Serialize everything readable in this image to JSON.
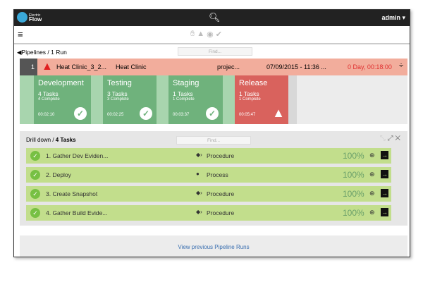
{
  "header": {
    "logo_small": "Electric",
    "logo_big": "Flow",
    "user": "admin"
  },
  "breadcrumb": "Pipelines / 1 Run",
  "find_placeholder": "Find...",
  "run": {
    "number": "1",
    "name": "Heat Clinic_3_2...",
    "pipeline": "Heat Clinic",
    "project": "projec...",
    "started": "07/09/2015 - 11:36 ...",
    "duration": "0 Day, 00:18:00"
  },
  "stages": [
    {
      "name": "Development",
      "tasks": "4 Tasks",
      "complete": "4 Complete",
      "time": "00:02:10",
      "status": "success"
    },
    {
      "name": "Testing",
      "tasks": "3 Tasks",
      "complete": "3 Complete",
      "time": "00:02:25",
      "status": "success"
    },
    {
      "name": "Staging",
      "tasks": "1 Tasks",
      "complete": "1 Complete",
      "time": "00:03:37",
      "status": "success"
    },
    {
      "name": "Release",
      "tasks": "1 Tasks",
      "complete": "1 Complete",
      "time": "00:05:47",
      "status": "warning"
    }
  ],
  "drill": {
    "prefix": "Drill down / ",
    "count": "4 Tasks",
    "tasks": [
      {
        "name": "1. Gather Dev Eviden...",
        "type": "Procedure",
        "percent": "100%"
      },
      {
        "name": "2. Deploy",
        "type": "Process",
        "percent": "100%"
      },
      {
        "name": "3. Create Snapshot",
        "type": "Procedure",
        "percent": "100%"
      },
      {
        "name": "4. Gather Build Evide...",
        "type": "Procedure",
        "percent": "100%"
      }
    ]
  },
  "footer_link": "View previous Pipeline Runs"
}
